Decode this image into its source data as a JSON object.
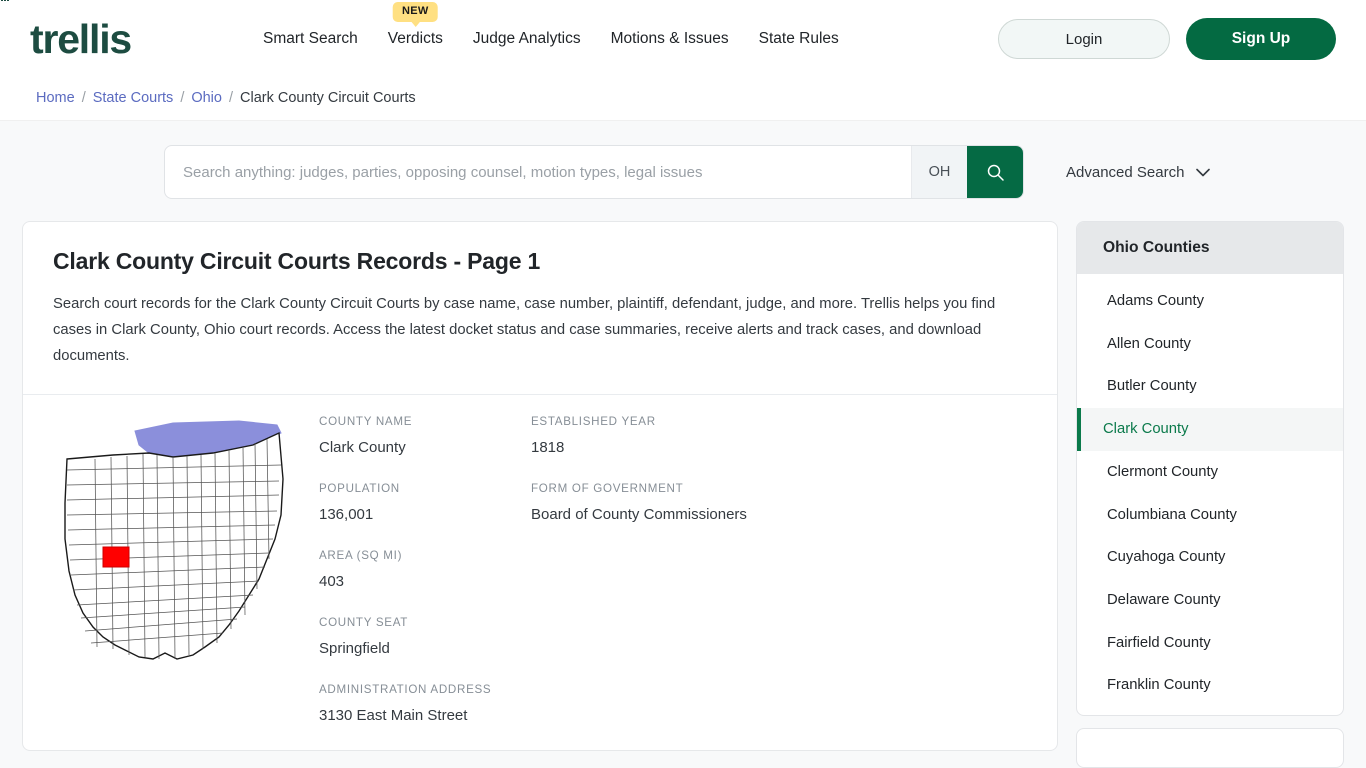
{
  "brand": {
    "name": "trellis",
    "color": "#1d4c41"
  },
  "nav": {
    "items": [
      {
        "label": "Smart Search",
        "badge": null
      },
      {
        "label": "Verdicts",
        "badge": "NEW"
      },
      {
        "label": "Judge Analytics",
        "badge": null
      },
      {
        "label": "Motions & Issues",
        "badge": null
      },
      {
        "label": "State Rules",
        "badge": null
      }
    ],
    "login_label": "Login",
    "signup_label": "Sign Up"
  },
  "breadcrumb": {
    "items": [
      "Home",
      "State Courts",
      "Ohio",
      "Clark County Circuit Courts"
    ],
    "separator": "/"
  },
  "search": {
    "placeholder": "Search anything: judges, parties, opposing counsel, motion types, legal issues",
    "value": "",
    "state_chip": "OH",
    "search_icon": "search-icon",
    "advanced_label": "Advanced Search",
    "chevron_icon": "chevron-down-icon",
    "button_color": "#056a44"
  },
  "main": {
    "title": "Clark County Circuit Courts Records - Page 1",
    "description": "Search court records for the Clark County Circuit Courts by case name, case number, plaintiff, defendant, judge, and more. Trellis helps you find cases in Clark County, Ohio court records. Access the latest docket status and case summaries, receive alerts and track cases, and download documents.",
    "map_alt": "ohio-county-map-clark-highlighted",
    "fields_left": [
      {
        "label": "COUNTY NAME",
        "value": "Clark County"
      },
      {
        "label": "POPULATION",
        "value": "136,001"
      },
      {
        "label": "AREA (SQ MI)",
        "value": "403"
      },
      {
        "label": "COUNTY SEAT",
        "value": "Springfield"
      },
      {
        "label": "ADMINISTRATION ADDRESS",
        "value": "3130 East Main Street"
      }
    ],
    "fields_right": [
      {
        "label": "ESTABLISHED YEAR",
        "value": "1818"
      },
      {
        "label": "FORM OF GOVERNMENT",
        "value": "Board of County Commissioners"
      }
    ]
  },
  "sidebar": {
    "heading": "Ohio Counties",
    "active": "Clark County",
    "accent": "#0b7a4b",
    "items": [
      {
        "label": "Adams County"
      },
      {
        "label": "Allen County"
      },
      {
        "label": "Butler County"
      },
      {
        "label": "Clark County"
      },
      {
        "label": "Clermont County"
      },
      {
        "label": "Columbiana County"
      },
      {
        "label": "Cuyahoga County"
      },
      {
        "label": "Delaware County"
      },
      {
        "label": "Fairfield County"
      },
      {
        "label": "Franklin County"
      }
    ]
  }
}
